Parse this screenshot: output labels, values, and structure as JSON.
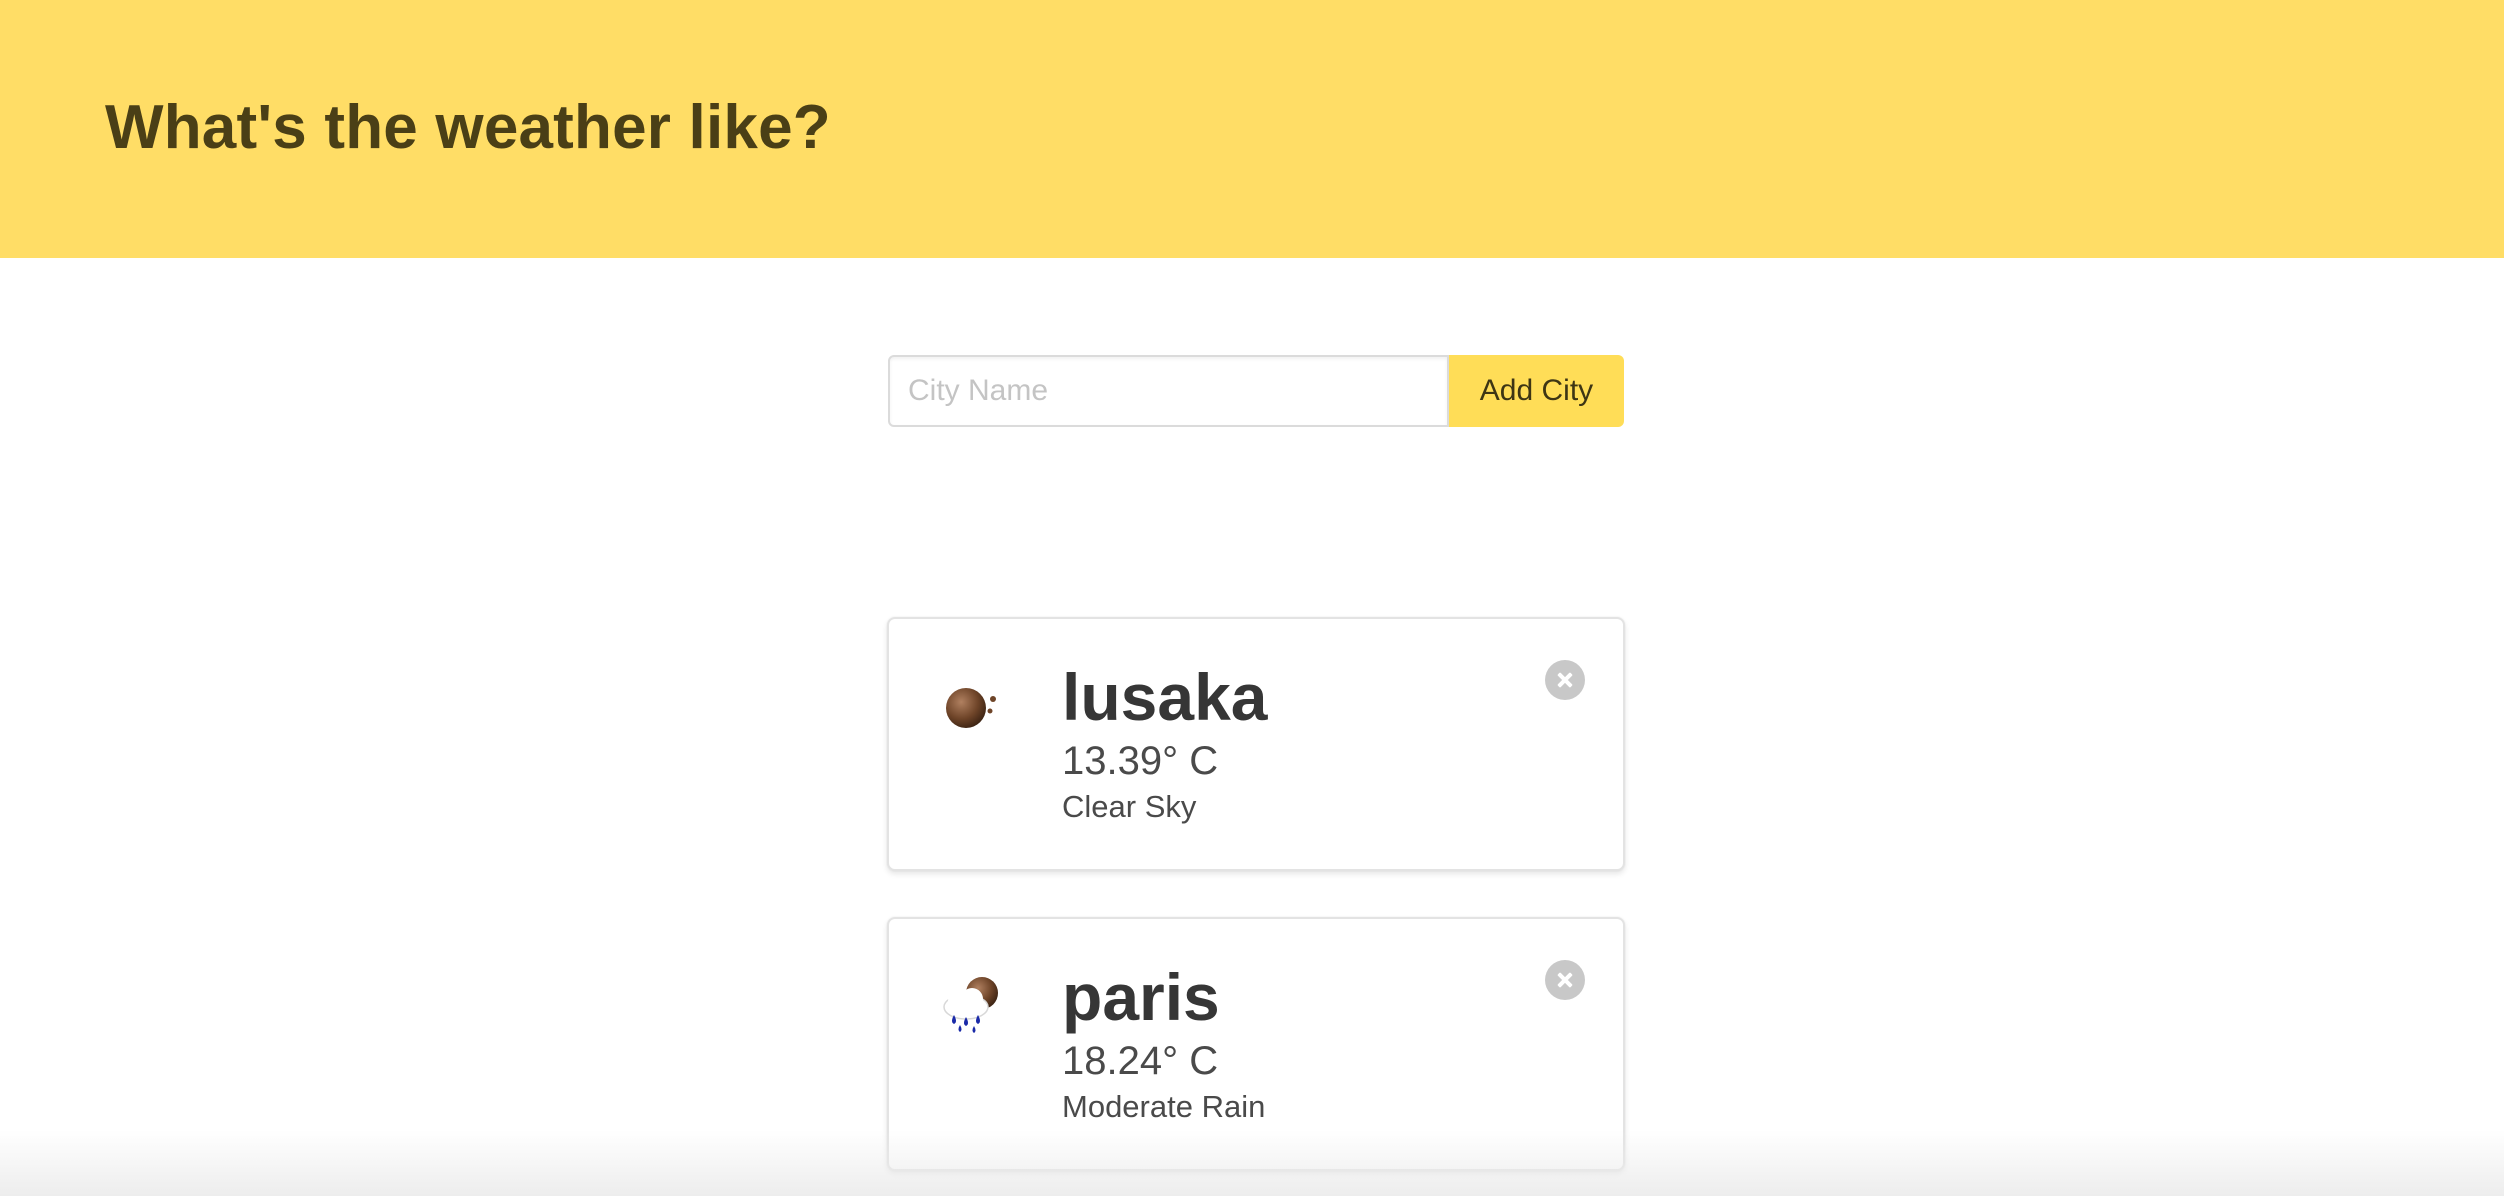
{
  "header": {
    "title": "What's the weather like?"
  },
  "form": {
    "input_placeholder": "City Name",
    "input_value": "",
    "button_label": "Add City"
  },
  "cities": [
    {
      "name": "lusaka",
      "temperature": "13.39° C",
      "description": "Clear Sky",
      "icon": "clear-night-icon"
    },
    {
      "name": "paris",
      "temperature": "18.24° C",
      "description": "Moderate Rain",
      "icon": "rain-night-icon"
    }
  ],
  "colors": {
    "hero_background": "#ffdd66",
    "hero_text": "#4a3f16",
    "button_background": "#ffdd57",
    "delete_button": "#c8c8c8"
  }
}
